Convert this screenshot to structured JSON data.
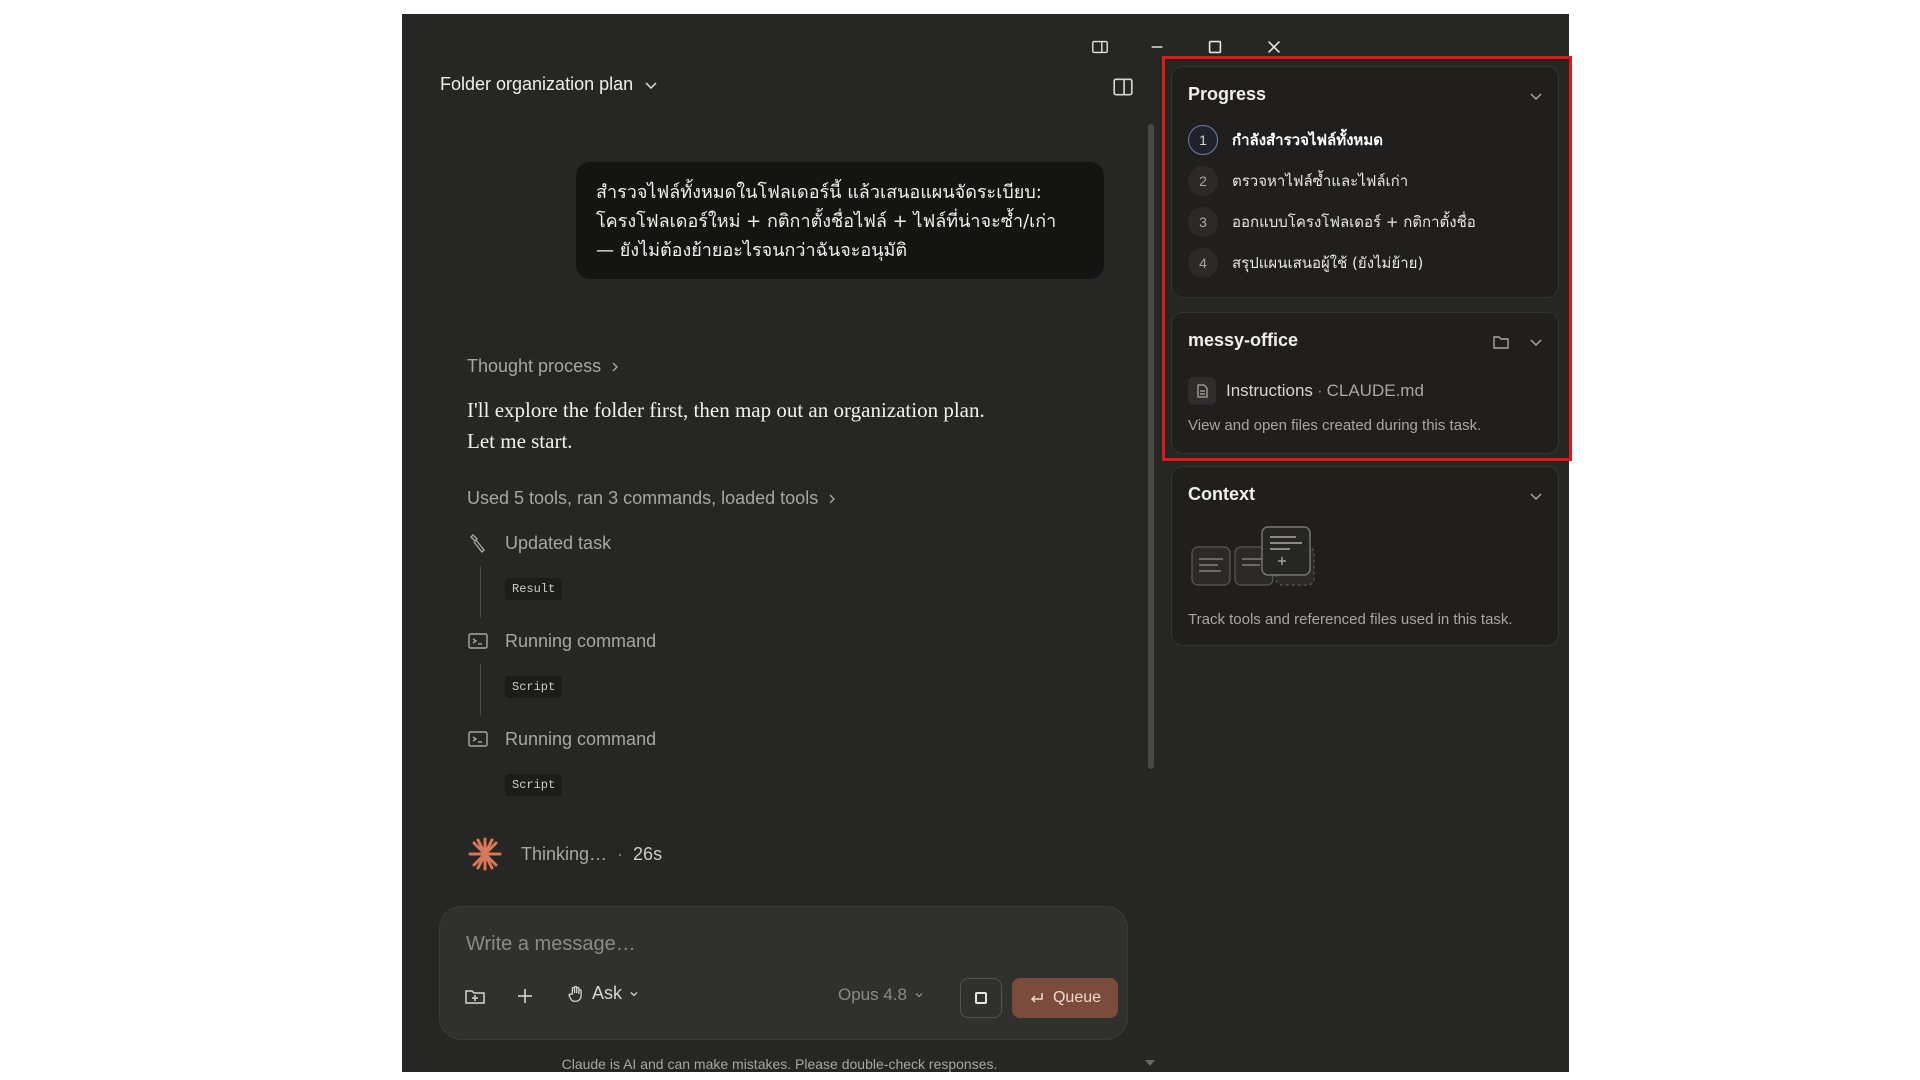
{
  "window": {
    "controls": {
      "sidebar_icon": "sidebar-toggle-icon",
      "minimize_icon": "minimize-icon",
      "maximize_icon": "maximize-icon",
      "close_icon": "close-icon"
    }
  },
  "chat": {
    "title": "Folder organization plan",
    "user_message": [
      "สำรวจไฟล์ทั้งหมดในโฟลเดอร์นี้ แล้วเสนอแผนจัดระเบียบ:",
      "โครงโฟลเดอร์ใหม่ + กติกาตั้งชื่อไฟล์ + ไฟล์ที่น่าจะซ้ำ/เก่า",
      "— ยังไม่ต้องย้ายอะไรจนกว่าฉันจะอนุมัติ"
    ],
    "thought_process_label": "Thought process",
    "assistant_text": [
      "I'll explore the folder first, then map out an organization plan.",
      "Let me start."
    ],
    "tools_summary": "Used 5 tools, ran 3 commands, loaded tools",
    "tools": [
      {
        "icon": "tool-icon",
        "label": "Updated task",
        "badge": "Result"
      },
      {
        "icon": "terminal-icon",
        "label": "Running command",
        "badge": "Script"
      },
      {
        "icon": "terminal-icon",
        "label": "Running command",
        "badge": "Script"
      }
    ],
    "thinking": {
      "label": "Thinking…",
      "separator": "·",
      "elapsed": "26s"
    }
  },
  "composer": {
    "placeholder": "Write a message…",
    "mode_label": "Ask",
    "model_label": "Opus 4.8",
    "queue_label": "Queue",
    "disclaimer": "Claude is AI and can make mistakes. Please double-check responses."
  },
  "sidebar": {
    "progress": {
      "title": "Progress",
      "steps": [
        {
          "num": "1",
          "text": "กำลังสำรวจไฟล์ทั้งหมด",
          "active": true
        },
        {
          "num": "2",
          "text": "ตรวจหาไฟล์ซ้ำและไฟล์เก่า",
          "active": false
        },
        {
          "num": "3",
          "text": "ออกแบบโครงโฟลเดอร์ + กติกาตั้งชื่อ",
          "active": false
        },
        {
          "num": "4",
          "text": "สรุปแผนเสนอผู้ใช้ (ยังไม่ย้าย)",
          "active": false
        }
      ]
    },
    "workspace": {
      "title": "messy-office",
      "file_name": "Instructions",
      "file_sep": "·",
      "file_path": "CLAUDE.md",
      "note": "View and open files created during this task."
    },
    "context": {
      "title": "Context",
      "note": "Track tools and referenced files used in this task."
    }
  },
  "colors": {
    "accent": "#7b4b3b",
    "background": "#262624",
    "highlight": "#e01a1a"
  }
}
